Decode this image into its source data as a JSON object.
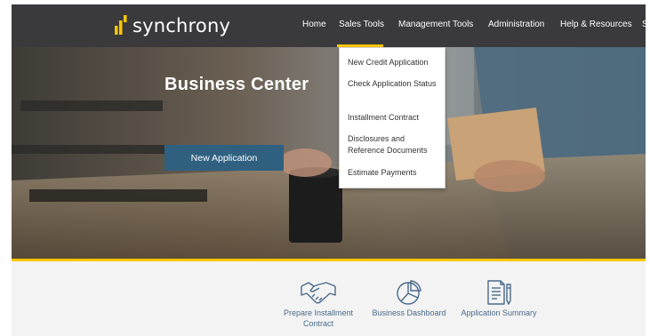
{
  "brand": {
    "name": "synchrony",
    "colors": {
      "accent": "#fbc600",
      "nav_bg": "#3a3a3c",
      "button": "#2f6080"
    }
  },
  "nav": {
    "items": [
      "Home",
      "Sales Tools",
      "Management Tools",
      "Administration",
      "Help & Resources",
      "S"
    ],
    "active": "Sales Tools"
  },
  "dropdown": {
    "items": [
      "New Credit Application",
      "Check Application Status",
      "Installment Contract",
      "Disclosures and Reference Documents",
      "Estimate Payments"
    ]
  },
  "hero": {
    "title": "Business Center",
    "button_label": "New Application"
  },
  "tiles": [
    {
      "label": "Prepare Installment Contract",
      "icon": "handshake-icon"
    },
    {
      "label": "Business Dashboard",
      "icon": "pie-chart-icon"
    },
    {
      "label": "Application Summary",
      "icon": "document-pencil-icon"
    }
  ]
}
